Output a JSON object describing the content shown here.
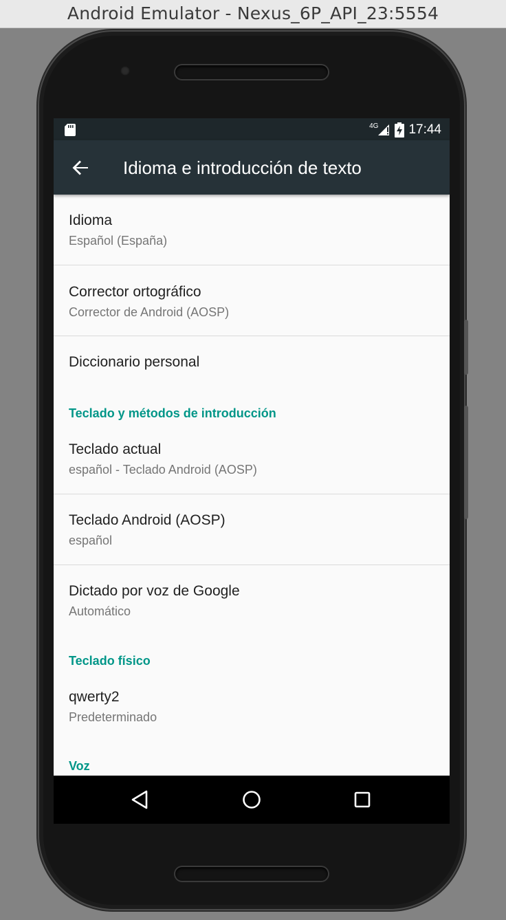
{
  "window": {
    "title": "Android Emulator - Nexus_6P_API_23:5554"
  },
  "statusbar": {
    "network": "4G",
    "time": "17:44",
    "sd_icon": "sd-card-icon",
    "signal_icon": "signal-icon",
    "battery_icon": "battery-icon"
  },
  "appbar": {
    "title": "Idioma e introducción de texto",
    "back_icon": "arrow-back-icon"
  },
  "items": {
    "idioma": {
      "title": "Idioma",
      "summary": "Español (España)"
    },
    "corrector": {
      "title": "Corrector ortográfico",
      "summary": "Corrector de Android (AOSP)"
    },
    "diccionario": {
      "title": "Diccionario personal"
    },
    "teclado_actual": {
      "title": "Teclado actual",
      "summary": "español - Teclado Android (AOSP)"
    },
    "teclado_aosp": {
      "title": "Teclado Android (AOSP)",
      "summary": "español"
    },
    "dictado": {
      "title": "Dictado por voz de Google",
      "summary": "Automático"
    },
    "qwerty": {
      "title": "qwerty2",
      "summary": "Predeterminado"
    }
  },
  "categories": {
    "teclado_metodos": "Teclado y métodos de introducción",
    "teclado_fisico": "Teclado físico",
    "voz": "Voz"
  },
  "colors": {
    "accent": "#009688",
    "appbar": "#263238",
    "statusbar": "#1e272b"
  },
  "navbar": {
    "back_icon": "nav-back-icon",
    "home_icon": "nav-home-icon",
    "recents_icon": "nav-recents-icon"
  }
}
